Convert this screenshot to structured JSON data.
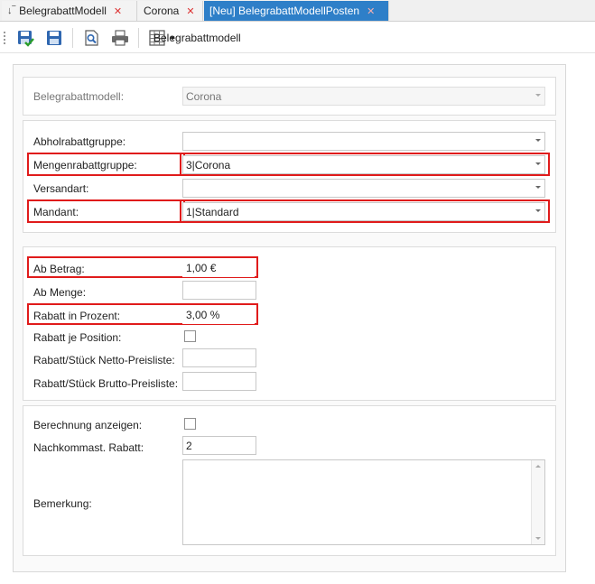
{
  "tabs": [
    {
      "label": "BelegrabattModell",
      "active": false
    },
    {
      "label": "Corona",
      "active": false
    },
    {
      "label": "[Neu] BelegrabattModellPosten",
      "active": true
    }
  ],
  "toolbar": {
    "menu_label": "Belegrabattmodell"
  },
  "form": {
    "group1": {
      "belegrabattmodell_label": "Belegrabattmodell:",
      "belegrabattmodell_value": "Corona"
    },
    "group2": {
      "abholrabattgruppe_label": "Abholrabattgruppe:",
      "abholrabattgruppe_value": "",
      "mengenrabattgruppe_label": "Mengenrabattgruppe:",
      "mengenrabattgruppe_value": "3|Corona",
      "versandart_label": "Versandart:",
      "versandart_value": "",
      "mandant_label": "Mandant:",
      "mandant_value": "1|Standard"
    },
    "group3": {
      "ab_betrag_label": "Ab Betrag:",
      "ab_betrag_value": "1,00 €",
      "ab_menge_label": "Ab Menge:",
      "ab_menge_value": "",
      "rabatt_prozent_label": "Rabatt in Prozent:",
      "rabatt_prozent_value": "3,00 %",
      "rabatt_position_label": "Rabatt je Position:",
      "rabatt_netto_label": "Rabatt/Stück Netto-Preisliste:",
      "rabatt_netto_value": "",
      "rabatt_brutto_label": "Rabatt/Stück Brutto-Preisliste:",
      "rabatt_brutto_value": ""
    },
    "group4": {
      "berechnung_label": "Berechnung anzeigen:",
      "nachkommast_label": "Nachkommast. Rabatt:",
      "nachkommast_value": "2",
      "bemerkung_label": "Bemerkung:",
      "bemerkung_value": ""
    }
  },
  "colors": {
    "active_tab": "#2e7fc8",
    "highlight": "#e01b1b",
    "close_icon": "#d33"
  }
}
